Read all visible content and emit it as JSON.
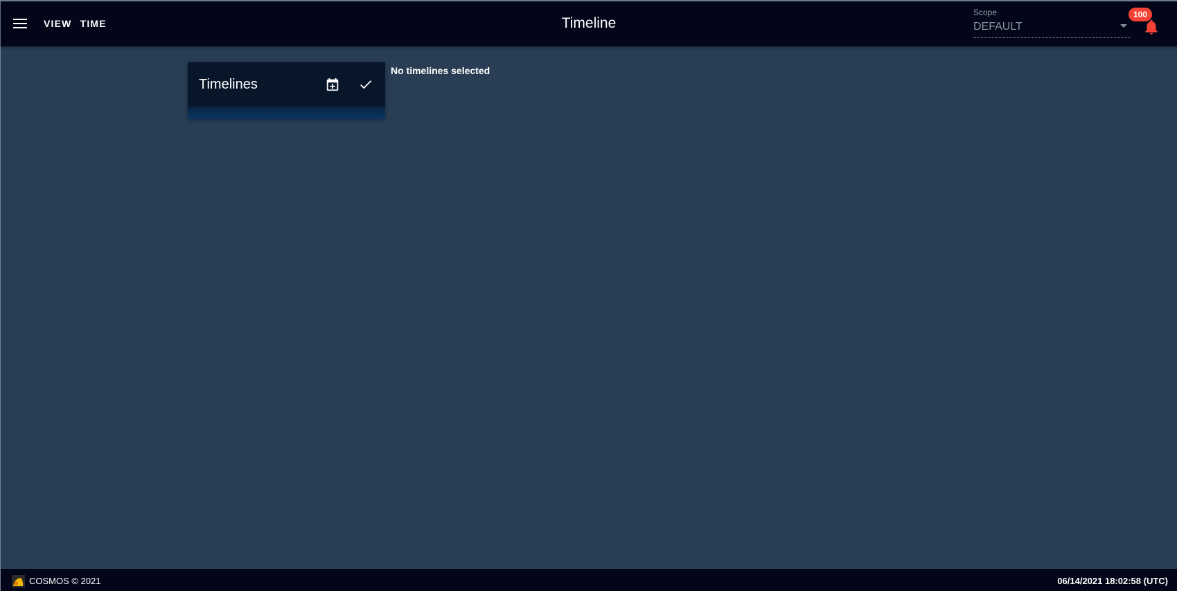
{
  "topbar": {
    "menu_icon": "hamburger-menu-icon",
    "menus": [
      "VIEW",
      "TIME"
    ],
    "title": "Timeline",
    "scope": {
      "label": "Scope",
      "value": "DEFAULT"
    },
    "notifications": {
      "icon": "bell-icon",
      "count": "100",
      "color": "#f44336"
    }
  },
  "timelines": {
    "title": "Timelines",
    "add_icon": "calendar-plus-icon",
    "confirm_icon": "check-icon"
  },
  "main": {
    "empty_message": "No timelines selected"
  },
  "footer": {
    "logo_icon": "cosmos-logo-icon",
    "copyright": "COSMOS © 2021",
    "datetime": "06/14/2021 18:02:58 (UTC)"
  },
  "colors": {
    "background": "#293e55",
    "bar": "#030619",
    "card": "#071629",
    "badge": "#f44336"
  }
}
